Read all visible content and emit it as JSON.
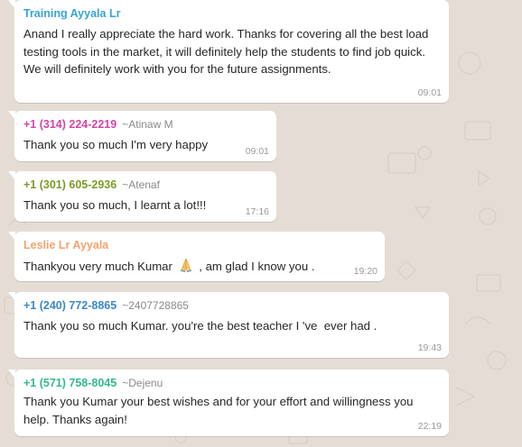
{
  "colors": {
    "background": "#e5ddd5",
    "bubble": "#ffffff",
    "timestamp": "#999999"
  },
  "messages": [
    {
      "sender": "Training Ayyala Lr",
      "sender_color": "#35a4d7",
      "name": "",
      "text": "Anand I really appreciate the hard work. Thanks for covering all the best load testing tools in the market, it will definitely help the students to find job quick. We will definitely work with you for the future assignments.",
      "time": "09:01"
    },
    {
      "sender": "+1 (314) 224-2219",
      "sender_color": "#d544a8",
      "name": "~Atinaw M",
      "text": "Thank you so much I'm very happy",
      "time": "09:01"
    },
    {
      "sender": "+1 (301) 605-2936",
      "sender_color": "#7a9c26",
      "name": "~Atenaf",
      "text": "Thank you so much, I learnt a lot!!!",
      "time": "17:16"
    },
    {
      "sender": "Leslie Lr Ayyala",
      "sender_color": "#f5a26b",
      "name": "",
      "text_before_emoji": "Thankyou very much Kumar ",
      "emoji": "folded-hands-icon",
      "text_after_emoji": " , am glad I know you .",
      "time": "19:20"
    },
    {
      "sender": "+1 (240) 772-8865",
      "sender_color": "#3d87c4",
      "name": "~2407728865",
      "text": "Thank you so much Kumar. you're the best teacher I 've  ever had .",
      "time": "19:43"
    },
    {
      "sender": "+1 (571) 758-8045",
      "sender_color": "#35b98a",
      "name": "~Dejenu",
      "text": "Thank you Kumar your best wishes and for your effort and willingness you help. Thanks again!",
      "time": "22:19"
    }
  ]
}
